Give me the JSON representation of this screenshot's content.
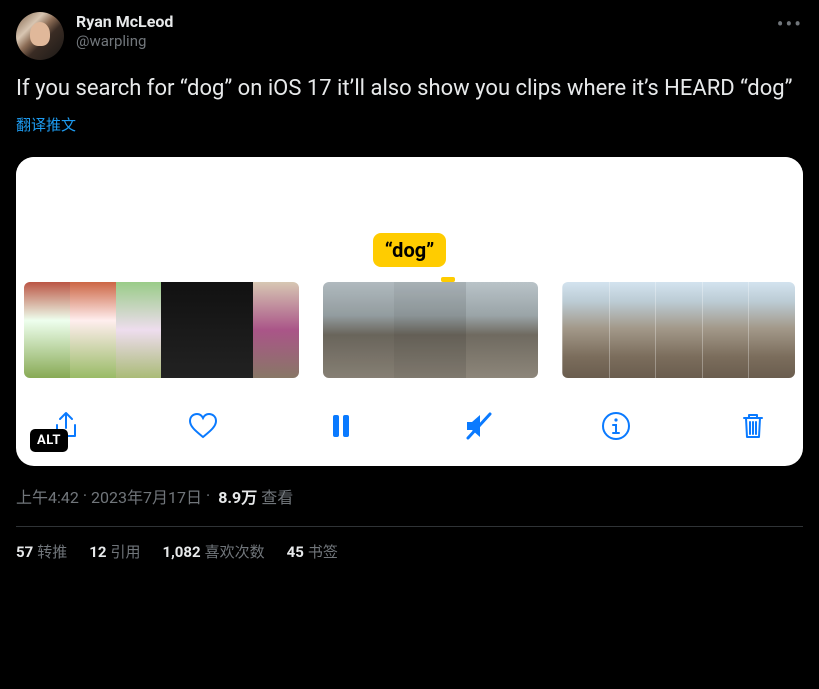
{
  "author": {
    "display_name": "Ryan McLeod",
    "handle": "@warpling"
  },
  "tweet_text": "If you search for “dog” on iOS 17 it’ll also show you clips where it’s HEARD “dog”",
  "translate_label": "翻译推文",
  "media": {
    "caption_chip": "“dog”",
    "alt_badge": "ALT",
    "toolbar": {
      "share": "share-icon",
      "like": "heart-icon",
      "pause": "pause-icon",
      "mute": "mute-icon",
      "info": "info-icon",
      "delete": "trash-icon"
    }
  },
  "meta": {
    "time": "上午4:42",
    "sep1": " · ",
    "date": "2023年7月17日",
    "sep2": " · ",
    "views_num": "8.9万",
    "views_label": " 查看"
  },
  "stats": {
    "retweets_num": "57",
    "retweets_label": "转推",
    "quotes_num": "12",
    "quotes_label": "引用",
    "likes_num": "1,082",
    "likes_label": "喜欢次数",
    "bookmarks_num": "45",
    "bookmarks_label": "书签"
  }
}
